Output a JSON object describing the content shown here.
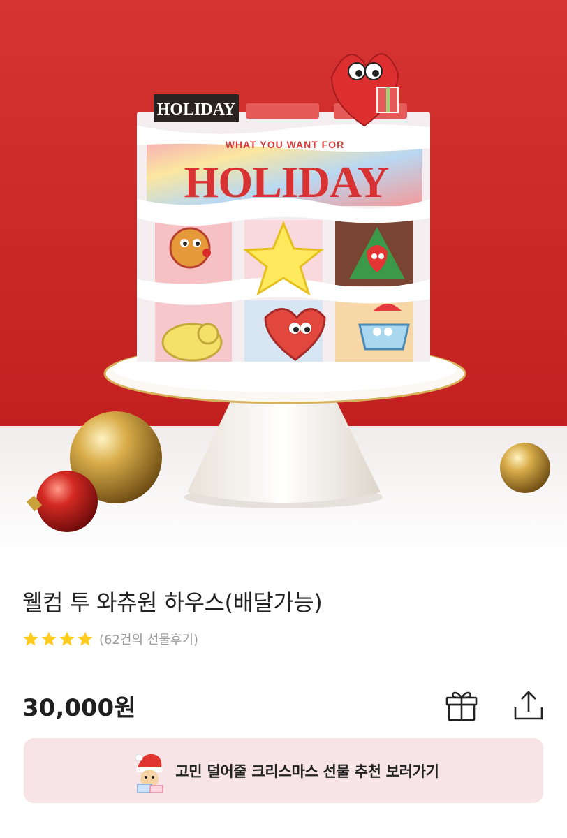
{
  "hero": {
    "image_alt": "Holiday cake box on a cake stand",
    "box_title": "HOLIDAY",
    "box_tagline": "WHAT YOU WANT FOR",
    "box_tag": "HOLIDAY"
  },
  "product": {
    "name": "웰컴 투 와츄원 하우스(배달가능)",
    "rating_stars": 4,
    "review_count_label": "(62건의 선물후기)",
    "price": "30,000원"
  },
  "actions": {
    "gift_icon": "gift-icon",
    "share_icon": "share-icon"
  },
  "banner": {
    "label": "고민 덜어줄 크리스마스 선물 추천 보러가기",
    "icon": "santa-character-icon"
  },
  "colors": {
    "star": "#ffcc1e",
    "banner_bg": "#f7e4e6",
    "hero_red": "#cf2a2a"
  }
}
